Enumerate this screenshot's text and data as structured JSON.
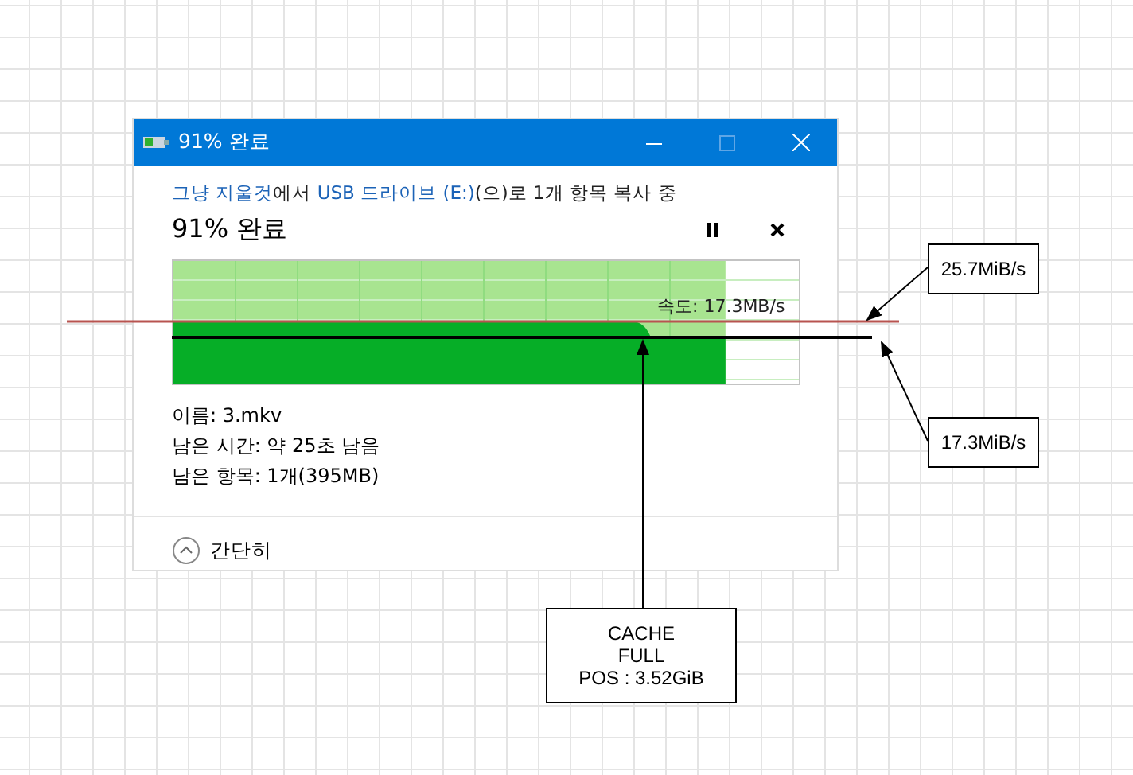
{
  "window": {
    "title": "91% 완료"
  },
  "copy_dialog": {
    "source_line": [
      {
        "text": "그냥 지울것",
        "kind": "link"
      },
      {
        "text": "에서 ",
        "kind": "plain"
      },
      {
        "text": "USB 드라이브 (E:)",
        "kind": "link"
      },
      {
        "text": "(으)로 1개 항목 복사 중",
        "kind": "plain"
      }
    ],
    "heading": "91% 완료",
    "progress": {
      "level": 0.91,
      "speed": "속도: 17.3MB/s"
    },
    "details": [
      "이름: 3.mkv",
      "남은 시간: 약 25초 남음",
      "남은 항목: 1개(395MB)"
    ],
    "collapse": "간단히"
  },
  "annotations": [
    {
      "text": "25.7MiB/s"
    },
    {
      "text": "17.3MiB/s"
    },
    {
      "text": "CACHE\nFULL\nPOS : 3.52GiB"
    }
  ]
}
